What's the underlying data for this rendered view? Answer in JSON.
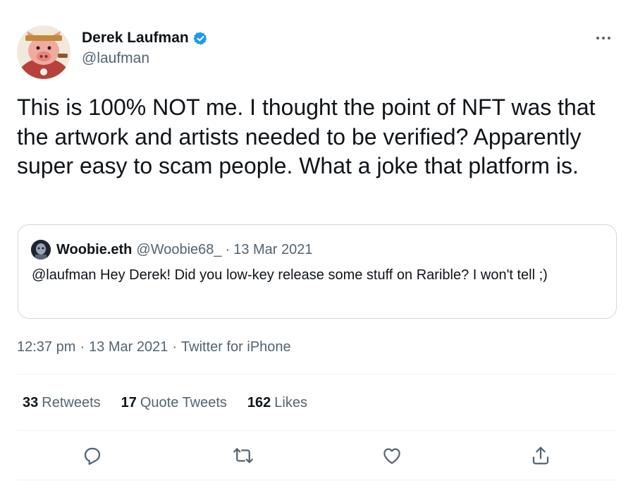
{
  "tweet": {
    "author_name": "Derek Laufman",
    "author_handle": "@laufman",
    "text": "This is 100% NOT me. I thought the point of NFT was that the artwork and artists needed to be verified? Apparently super easy to scam people. What a joke that platform is.",
    "time": "12:37 pm",
    "date": "13 Mar 2021",
    "source": "Twitter for iPhone",
    "separator": "·"
  },
  "quote": {
    "author_name": "Woobie.eth",
    "author_handle": "@Woobie68_",
    "separator": "·",
    "date": "13 Mar 2021",
    "text": "@laufman Hey Derek! Did you low-key release some stuff on Rarible? I won't tell ;)"
  },
  "stats": {
    "retweets_count": "33",
    "retweets_label": "Retweets",
    "quotes_count": "17",
    "quotes_label": "Quote Tweets",
    "likes_count": "162",
    "likes_label": "Likes"
  },
  "colors": {
    "verified": "#1d9bf0",
    "secondary_text": "#536471",
    "primary_text": "#0f1419",
    "border": "#cfd9de"
  },
  "icons": {
    "reply": "reply-icon",
    "retweet": "retweet-icon",
    "like": "like-icon",
    "share": "share-icon",
    "more": "more-icon",
    "verified": "verified-badge-icon"
  }
}
